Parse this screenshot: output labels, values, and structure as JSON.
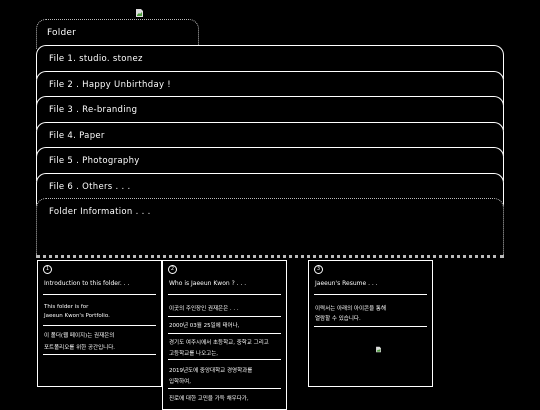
{
  "folder": {
    "tab_label": "Folder",
    "files": [
      "File 1. studio. stonez",
      "File 2 . Happy Unbirthday !",
      "File 3 . Re-branding",
      "File 4. Paper",
      "File 5 . Photography",
      "File 6 . Others . . ."
    ],
    "info_label": "Folder Information . . ."
  },
  "cards": [
    {
      "number": "1",
      "title": "Introduction to this folder. . .",
      "lines": [
        "This folder is for",
        "Jaeeun Kwon's Portfolio.",
        "이 폴더(웹 페이지)는 권재은의",
        "포트폴리오를 위한 공간입니다."
      ]
    },
    {
      "number": "2",
      "title": "Who is Jaeeun Kwon ? . . .",
      "lines": [
        "이곳의 주인장인 권재은은 . . .",
        "2000년 03월 25일에 태어나,",
        "경기도 여주시에서 초등학교, 중학교 그리고",
        "고등학교를 나오고는,",
        "2019년도에 중앙대학교 경영학과를",
        "입학하여,",
        "진로에 대한 고민을 가득 채우다가,"
      ]
    },
    {
      "number": "3",
      "title": "Jaeeun's Resume . . .",
      "lines": [
        "이력서는 아래의 아이콘을 통해",
        "열람할 수 있습니다."
      ]
    }
  ]
}
